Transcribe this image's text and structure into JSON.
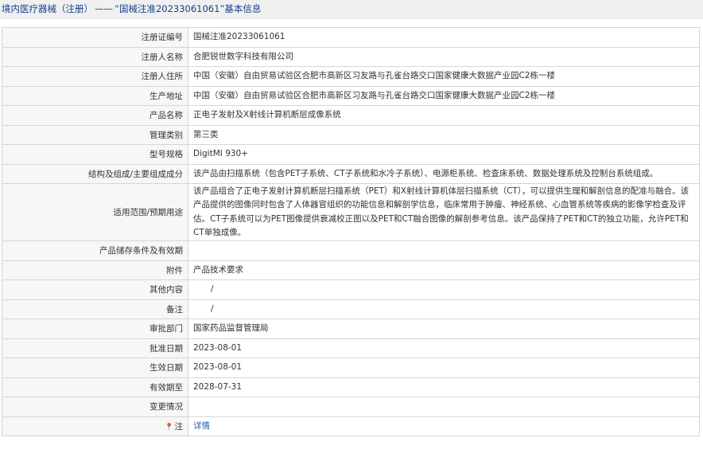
{
  "header": {
    "category": "境内医疗器械（注册）",
    "separator": "——",
    "title": "“国械注准20233061061”基本信息"
  },
  "rows": [
    {
      "label": "注册证编号",
      "value": "国械注准20233061061"
    },
    {
      "label": "注册人名称",
      "value": "合肥锐世数字科技有限公司"
    },
    {
      "label": "注册人住所",
      "value": "中国（安徽）自由贸易试验区合肥市高新区习友路与孔雀台路交口国家健康大数据产业园C2栋一楼"
    },
    {
      "label": "生产地址",
      "value": "中国（安徽）自由贸易试验区合肥市高新区习友路与孔雀台路交口国家健康大数据产业园C2栋一楼"
    },
    {
      "label": "产品名称",
      "value": "正电子发射及X射线计算机断层成像系统"
    },
    {
      "label": "管理类别",
      "value": "第三类"
    },
    {
      "label": "型号规格",
      "value": "DigitMI 930+"
    },
    {
      "label": "结构及组成/主要组成成分",
      "value": "该产品由扫描系统（包含PET子系统、CT子系统和水冷子系统）、电源柜系统、检查床系统、数据处理系统及控制台系统组成。"
    },
    {
      "label": "适用范围/预期用途",
      "value": "该产品组合了正电子发射计算机断层扫描系统（PET）和X射线计算机体层扫描系统（CT），可以提供生理和解剖信息的配准与融合。该产品提供的图像同时包含了人体器官组织的功能信息和解剖学信息，临床常用于肿瘤、神经系统、心血管系统等疾病的影像学检查及评估。CT子系统可以为PET图像提供衰减校正图以及PET和CT融合图像的解剖参考信息。该产品保持了PET和CT的独立功能，允许PET和CT单独成像。"
    },
    {
      "label": "产品储存条件及有效期",
      "value": ""
    },
    {
      "label": "附件",
      "value": "产品技术要求"
    },
    {
      "label": "其他内容",
      "value": "/"
    },
    {
      "label": "备注",
      "value": "/"
    },
    {
      "label": "审批部门",
      "value": "国家药品监督管理局"
    },
    {
      "label": "批准日期",
      "value": "2023-08-01"
    },
    {
      "label": "生效日期",
      "value": "2023-08-01"
    },
    {
      "label": "有效期至",
      "value": "2028-07-31"
    },
    {
      "label": "变更情况",
      "value": ""
    }
  ],
  "note": {
    "label": "注",
    "icon": "pin-icon",
    "link_text": "详情",
    "link_color": "#1a5fb4"
  },
  "colors": {
    "header_text": "#1a3e8c",
    "header_bg": "#f0f0f0",
    "label_bg": "#f7f7f7",
    "border": "#d6d6d6"
  }
}
